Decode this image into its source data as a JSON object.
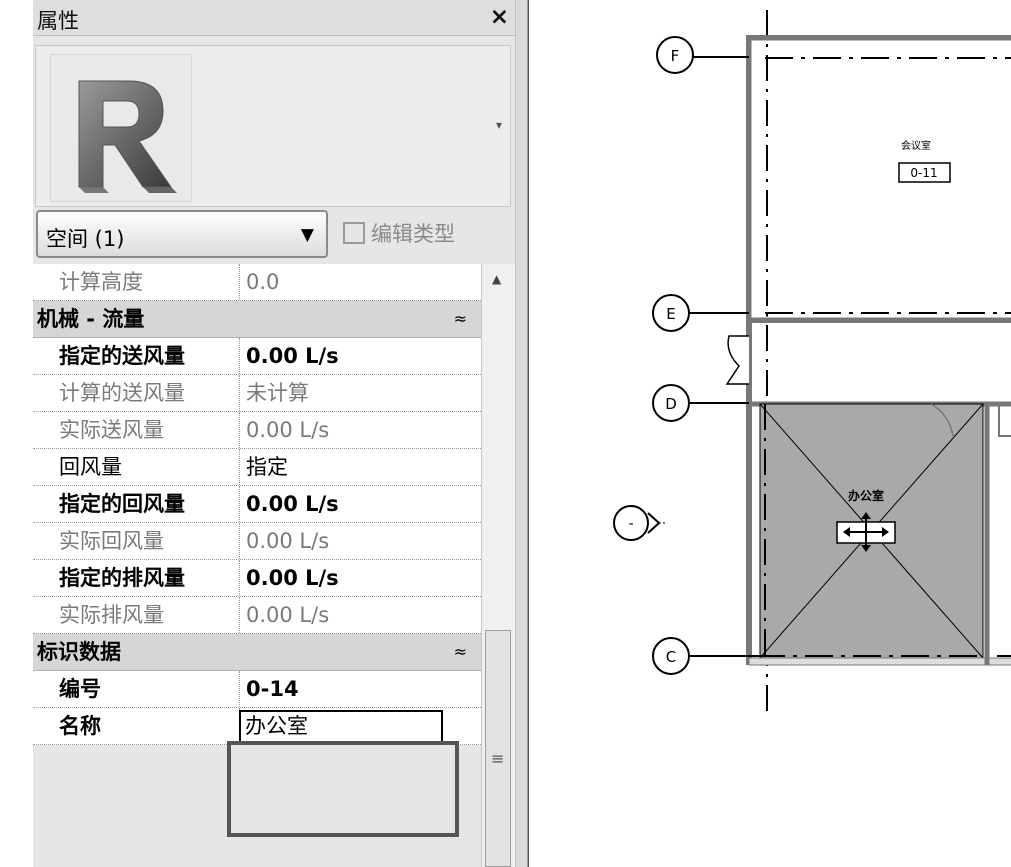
{
  "panel": {
    "title": "属性",
    "close_symbol": "×",
    "preview_dropdown_symbol": "▾",
    "type_selector": {
      "label": "空间 (1)",
      "arrow": "▼"
    },
    "edit_type_label": "编辑类型"
  },
  "properties": {
    "row_calc_height": {
      "name": "计算高度",
      "value": "0.0"
    },
    "group_mech": {
      "name": "机械 - 流量",
      "collapse": "≈"
    },
    "row_spec_supply": {
      "name": "指定的送风量",
      "value": "0.00 L/s"
    },
    "row_calc_supply": {
      "name": "计算的送风量",
      "value": "未计算"
    },
    "row_actual_supply": {
      "name": "实际送风量",
      "value": "0.00 L/s"
    },
    "row_return": {
      "name": "回风量",
      "value": "指定"
    },
    "row_spec_return": {
      "name": "指定的回风量",
      "value": "0.00 L/s"
    },
    "row_actual_return": {
      "name": "实际回风量",
      "value": "0.00 L/s"
    },
    "row_spec_exhaust": {
      "name": "指定的排风量",
      "value": "0.00 L/s"
    },
    "row_actual_exhaust": {
      "name": "实际排风量",
      "value": "0.00 L/s"
    },
    "group_identity": {
      "name": "标识数据",
      "collapse": "≈"
    },
    "row_number": {
      "name": "编号",
      "value": "0-14"
    },
    "row_name": {
      "name": "名称",
      "value": "办公室"
    }
  },
  "scrollbar": {
    "up_symbol": "▲",
    "grip_symbol": "≡"
  },
  "drawing": {
    "grid_F": "F",
    "grid_E": "E",
    "grid_D": "D",
    "grid_C": "C",
    "grid_blank": "-",
    "room_top_name": "会议室",
    "room_top_tag": "0-11",
    "room_office_name": "办公室"
  },
  "colors": {
    "selected_room": "#a9a9a9",
    "panel_bg": "#e6e6e6",
    "highlight_box": "#555555"
  }
}
